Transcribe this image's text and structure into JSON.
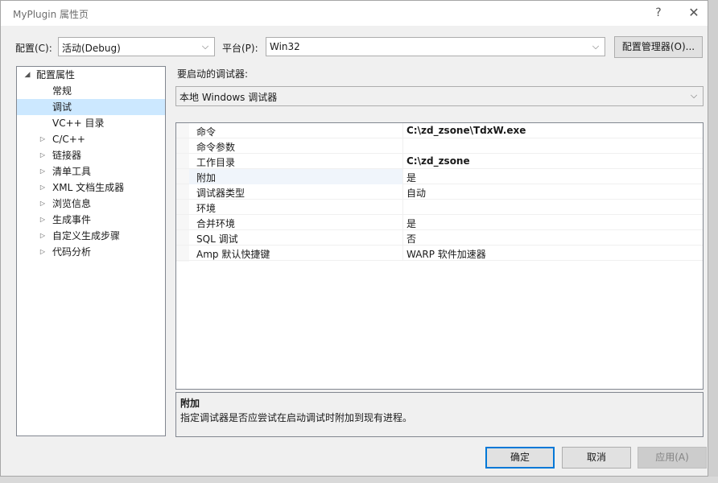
{
  "window": {
    "title": "MyPlugin 属性页",
    "help": "?",
    "close": "✕"
  },
  "config": {
    "config_label": "配置(C):",
    "config_value": "活动(Debug)",
    "platform_label": "平台(P):",
    "platform_value": "Win32",
    "manager_button": "配置管理器(O)..."
  },
  "debugger": {
    "label": "要启动的调试器:",
    "value": "本地 Windows 调试器"
  },
  "tree": {
    "root": "配置属性",
    "items": [
      {
        "label": "常规",
        "expandable": false
      },
      {
        "label": "调试",
        "expandable": false,
        "selected": true
      },
      {
        "label": "VC++ 目录",
        "expandable": false
      },
      {
        "label": "C/C++",
        "expandable": true
      },
      {
        "label": "链接器",
        "expandable": true
      },
      {
        "label": "清单工具",
        "expandable": true
      },
      {
        "label": "XML 文档生成器",
        "expandable": true
      },
      {
        "label": "浏览信息",
        "expandable": true
      },
      {
        "label": "生成事件",
        "expandable": true
      },
      {
        "label": "自定义生成步骤",
        "expandable": true
      },
      {
        "label": "代码分析",
        "expandable": true
      }
    ]
  },
  "properties": [
    {
      "key": "命令",
      "value": "C:\\zd_zsone\\TdxW.exe",
      "bold": true
    },
    {
      "key": "命令参数",
      "value": "",
      "bold": false
    },
    {
      "key": "工作目录",
      "value": "C:\\zd_zsone",
      "bold": true
    },
    {
      "key": "附加",
      "value": "是",
      "bold": false
    },
    {
      "key": "调试器类型",
      "value": "自动",
      "bold": false
    },
    {
      "key": "环境",
      "value": "",
      "bold": false
    },
    {
      "key": "合并环境",
      "value": "是",
      "bold": false
    },
    {
      "key": "SQL 调试",
      "value": "否",
      "bold": false
    },
    {
      "key": "Amp 默认快捷键",
      "value": "WARP 软件加速器",
      "bold": false
    }
  ],
  "description": {
    "title": "附加",
    "text": "指定调试器是否应尝试在启动调试时附加到现有进程。"
  },
  "buttons": {
    "ok": "确定",
    "cancel": "取消",
    "apply": "应用(A)"
  },
  "icons": {
    "dropdown": "chevron-down-icon",
    "expanded": "triangle-expanded-icon",
    "collapsed": "triangle-collapsed-icon"
  }
}
